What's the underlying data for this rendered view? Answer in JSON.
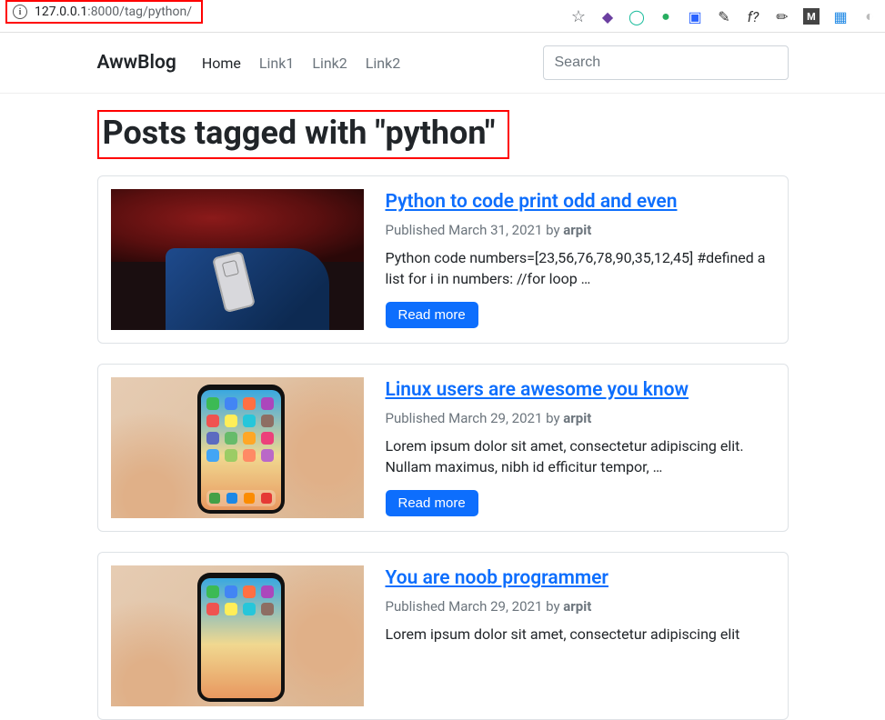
{
  "browser": {
    "url_host": "127.0.0.1",
    "url_port": ":8000",
    "url_path": "/tag/python/"
  },
  "nav": {
    "brand": "AwwBlog",
    "links": [
      "Home",
      "Link1",
      "Link2",
      "Link2"
    ],
    "active_index": 0,
    "search_placeholder": "Search"
  },
  "page": {
    "title": "Posts tagged with \"python\""
  },
  "posts": [
    {
      "title": "Python to code print odd and even",
      "published_prefix": "Published ",
      "date": "March 31, 2021",
      "by": " by ",
      "author": "arpit",
      "excerpt": "Python code numbers=[23,56,76,78,90,35,12,45] #defined a list for i in numbers: //for loop …",
      "button": "Read more",
      "thumb": "sweater"
    },
    {
      "title": "Linux users are awesome you know",
      "published_prefix": "Published ",
      "date": "March 29, 2021",
      "by": " by ",
      "author": "arpit",
      "excerpt": "Lorem ipsum dolor sit amet, consectetur adipiscing elit. Nullam maximus, nibh id efficitur tempor, …",
      "button": "Read more",
      "thumb": "phone"
    },
    {
      "title": "You are noob programmer",
      "published_prefix": "Published ",
      "date": "March 29, 2021",
      "by": " by ",
      "author": "arpit",
      "excerpt": "Lorem ipsum dolor sit amet, consectetur adipiscing elit",
      "button": "Read more",
      "thumb": "phone"
    }
  ]
}
